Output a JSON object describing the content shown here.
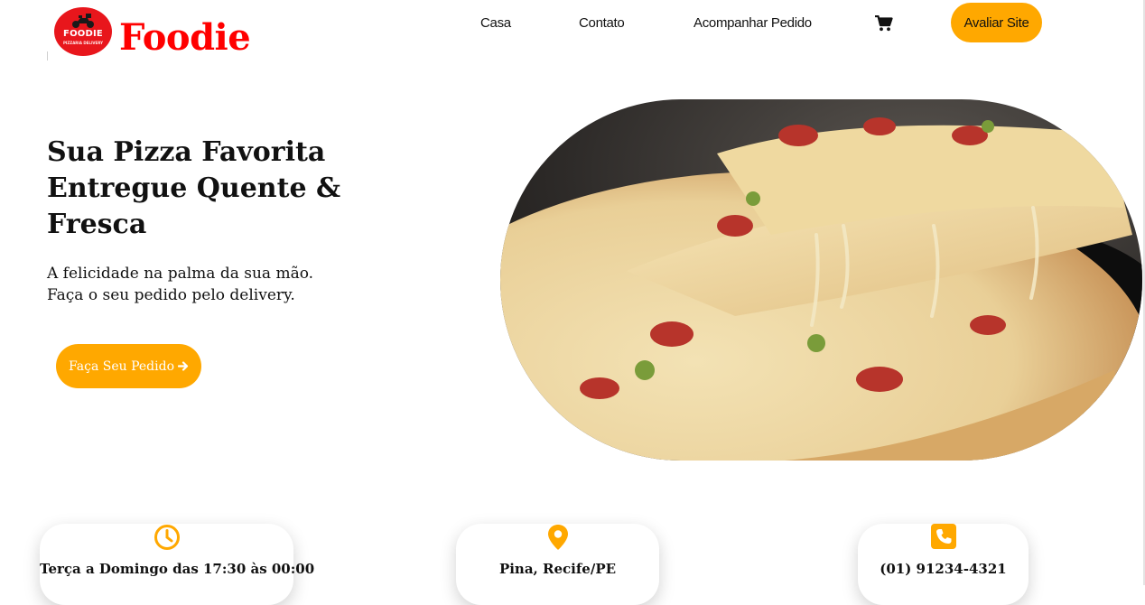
{
  "header": {
    "logo": {
      "badge_title": "FOODIE",
      "badge_subtitle": "PIZZARIA DELIVERY",
      "icon": "scooter-icon",
      "color": "#e8161c"
    },
    "brand": "Foodie",
    "brand_color": "#ff0000",
    "nav": [
      {
        "label": "Casa"
      },
      {
        "label": "Contato"
      },
      {
        "label": "Acompanhar Pedido"
      }
    ],
    "cart_icon": "shopping-cart-icon",
    "rate_button": "Avaliar Site",
    "accent": "#ffa800"
  },
  "hero": {
    "title": "Sua Pizza Favorita Entregue Quente & Fresca",
    "subtitle_lines": [
      "A felicidade na palma da sua mão.",
      "Faça o seu pedido pelo delivery."
    ],
    "cta": "Faça Seu Pedido",
    "cta_icon": "arrow-right-icon",
    "image": "pizza-slice-photo"
  },
  "info": [
    {
      "icon": "clock-icon",
      "text": "Terça a Domingo das 17:30 às 00:00"
    },
    {
      "icon": "map-pin-icon",
      "text": "Pina, Recife/PE"
    },
    {
      "icon": "phone-icon",
      "text": "(01) 91234-4321"
    }
  ]
}
